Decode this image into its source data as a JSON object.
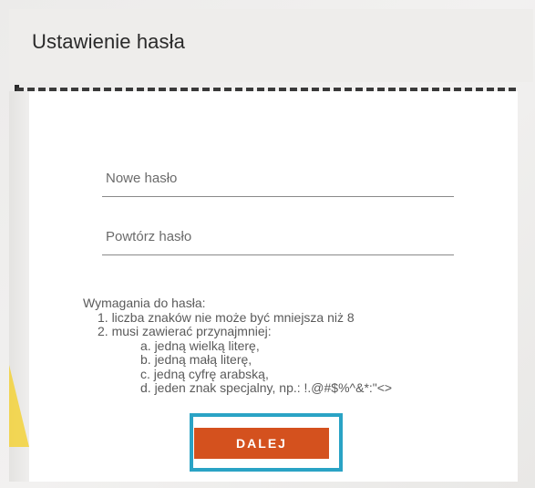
{
  "header": {
    "title": "Ustawienie hasła"
  },
  "form": {
    "new_password_placeholder": "Nowe hasło",
    "repeat_password_placeholder": "Powtórz hasło"
  },
  "requirements": {
    "heading": "Wymagania do hasła:",
    "rule1": "1. liczba znaków nie może być mniejsza niż 8",
    "rule2": "2. musi zawierać przynajmniej:",
    "sub_a": "a. jedną wielką literę,",
    "sub_b": "b. jedną małą literę,",
    "sub_c": "c. jedną cyfrę arabską,",
    "sub_d": "d. jeden znak specjalny, np.: !.@#$%^&*:\"<>"
  },
  "actions": {
    "next_label": "DALEJ"
  },
  "colors": {
    "accent": "#d4511e",
    "highlight": "#2aa3c5",
    "decor": "#f3d23a"
  }
}
